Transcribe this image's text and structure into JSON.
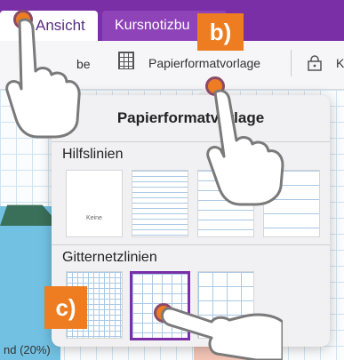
{
  "tabs": {
    "active_label": "Ansicht",
    "other_label": "Kursnotizbu"
  },
  "toolbar": {
    "partial_label": "be",
    "paper_format_label": "Papierformatvorlage",
    "partial_right_label": "K"
  },
  "popover": {
    "title": "Papierformatvorlage",
    "section_guidelines": "Hilfslinien",
    "none_label": "Keine",
    "section_grid": "Gitternetzlinien"
  },
  "canvas": {
    "legend_text": "nd (20%)"
  },
  "badges": {
    "b": "b)",
    "c": "c)"
  },
  "colors": {
    "accent_purple": "#7a2fa7",
    "badge_orange": "#ee7d22"
  }
}
